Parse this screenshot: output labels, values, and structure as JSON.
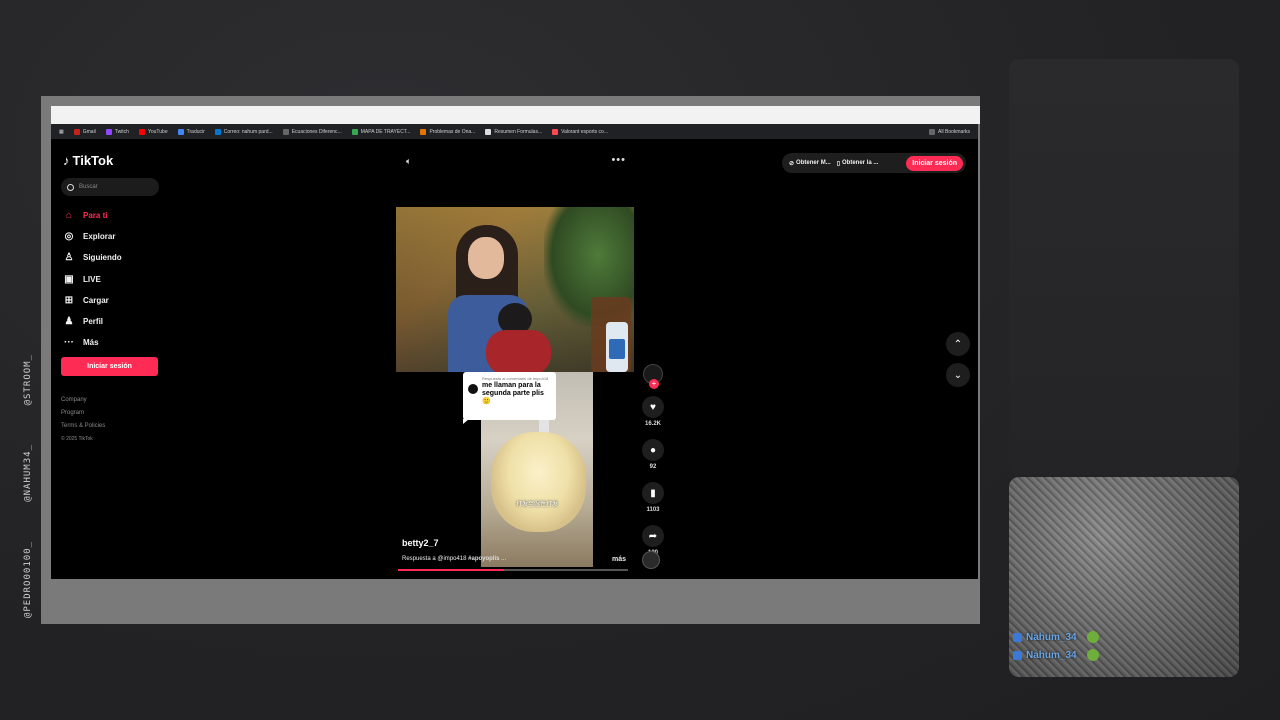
{
  "overlay": {
    "handles": [
      "@STROOM_",
      "@NAHUM34_",
      "@PEDRO00100_"
    ]
  },
  "bookmarks": {
    "items": [
      "Gmail",
      "Twitch",
      "YouTube",
      "Traducir",
      "Correo: nahum pard...",
      "Ecuaciones Diferenc...",
      "MAPA DE TRAYECT...",
      "Problemas de Ona...",
      "Resumen Formulas...",
      "Valorant esports co..."
    ],
    "right": "All Bookmarks"
  },
  "tiktok": {
    "logo": "TikTok",
    "search_placeholder": "Buscar",
    "nav": [
      {
        "label": "Para ti",
        "icon": "home-icon"
      },
      {
        "label": "Explorar",
        "icon": "compass-icon"
      },
      {
        "label": "Siguiendo",
        "icon": "following-icon"
      },
      {
        "label": "LIVE",
        "icon": "live-icon"
      },
      {
        "label": "Cargar",
        "icon": "upload-icon"
      },
      {
        "label": "Perfil",
        "icon": "profile-icon"
      },
      {
        "label": "Más",
        "icon": "more-icon"
      }
    ],
    "login_button": "Iniciar sesión",
    "footer": [
      "Company",
      "Program",
      "Terms & Policies",
      "© 2025 TikTok"
    ],
    "top_right": {
      "get_app": "Obtener M...",
      "get_desktop": "Obtener la ...",
      "login": "Iniciar sesión"
    },
    "video": {
      "comment_meta": "Respuesta al comentario de impo418",
      "comment_text": "me llaman para la segunda parte plis 🙂",
      "subtitle": "打发至湿性打发",
      "author": "betty2_7",
      "caption_prefix": "Respuesta a @impo418",
      "caption_hashtag": "#apoyoplis",
      "caption_suffix": "...",
      "more": "más",
      "progress": 0.46
    },
    "actions": {
      "likes": "16.2K",
      "comments": "92",
      "saves": "1103",
      "shares": "120"
    }
  },
  "chat": {
    "lines": [
      "Nahum_34",
      "Nahum_34"
    ]
  }
}
